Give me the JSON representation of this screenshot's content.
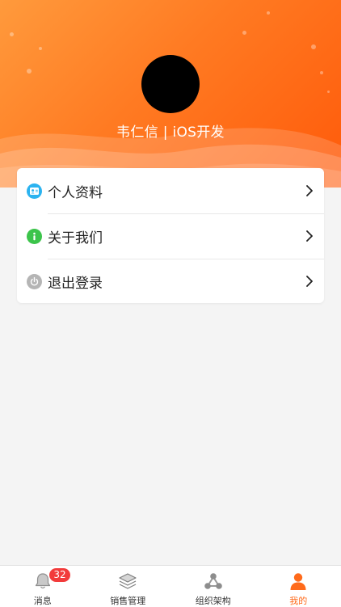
{
  "profile": {
    "user_line": "韦仁信 | iOS开发"
  },
  "menu": {
    "items": [
      {
        "label": "个人资料",
        "icon": "profile-card-icon",
        "color": "#2bb3f0"
      },
      {
        "label": "关于我们",
        "icon": "info-icon",
        "color": "#3cc44b"
      },
      {
        "label": "退出登录",
        "icon": "power-icon",
        "color": "#b5b5b5"
      }
    ]
  },
  "tabbar": {
    "tabs": [
      {
        "label": "消息",
        "icon": "bell-icon",
        "badge": "32"
      },
      {
        "label": "销售管理",
        "icon": "layers-icon"
      },
      {
        "label": "组织架构",
        "icon": "org-structure-icon"
      },
      {
        "label": "我的",
        "icon": "person-icon",
        "active": true
      }
    ]
  },
  "colors": {
    "accent": "#ff6a1a",
    "badge": "#f23b3b"
  }
}
